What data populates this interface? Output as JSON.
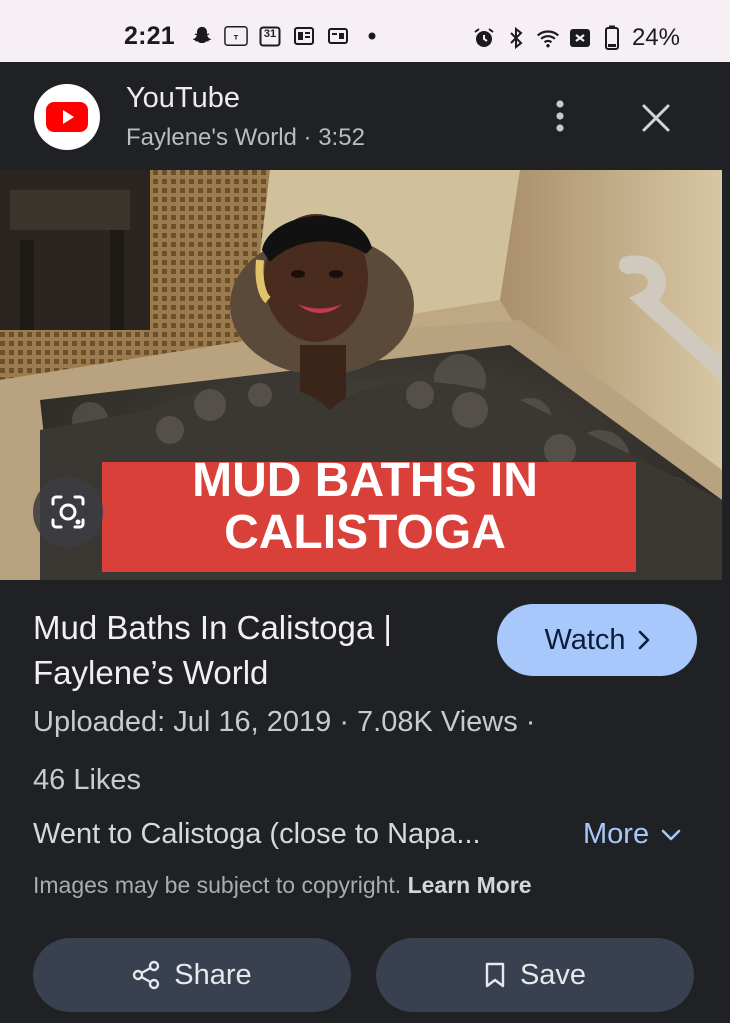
{
  "status_bar": {
    "time": "2:21",
    "left_icons": [
      "snapchat-icon",
      "temu-icon",
      "calendar-31-icon",
      "news-icon",
      "news-alt-icon",
      "dot-icon"
    ],
    "calendar_day": "31",
    "battery": "24%",
    "right_icons": [
      "alarm-icon",
      "bluetooth-icon",
      "wifi-icon",
      "mobile-data-off-icon",
      "battery-icon"
    ]
  },
  "header": {
    "app_name": "YouTube",
    "subtitle": "Faylene's World · 3:52",
    "brand_color": "#ff0000"
  },
  "thumbnail": {
    "overlay_line1": "MUD BATHS IN",
    "overlay_line2": "CALISTOGA",
    "banner_color": "#d9403a"
  },
  "video": {
    "title": "Mud Baths In Calistoga | Faylene’s World",
    "watch_label": "Watch",
    "meta": "Uploaded: Jul 16, 2019 · 7.08K Views ·",
    "likes": "46 Likes",
    "description": "Went to Calistoga (close to Napa...",
    "more_label": "More"
  },
  "copyright": {
    "text": "Images may be subject to copyright.",
    "link": "Learn More"
  },
  "actions": {
    "share_label": "Share",
    "save_label": "Save"
  },
  "colors": {
    "background": "#1f2125",
    "accent": "#a8c7fa",
    "button_bg": "#394150"
  }
}
